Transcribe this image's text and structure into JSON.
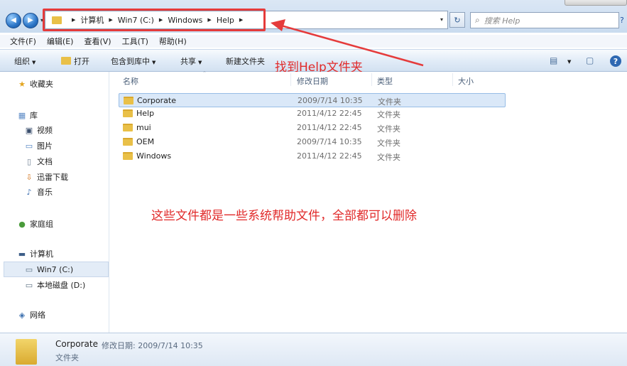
{
  "nav": {
    "back_glyph": "◀",
    "forward_glyph": "▶"
  },
  "address": {
    "crumbs": [
      "计算机",
      "Win7 (C:)",
      "Windows",
      "Help"
    ],
    "search_placeholder": "搜索 Help"
  },
  "menu": [
    "文件(F)",
    "编辑(E)",
    "查看(V)",
    "工具(T)",
    "帮助(H)"
  ],
  "toolbar": {
    "organize": "组织",
    "open": "打开",
    "include_in_library": "包含到库中",
    "share": "共享",
    "new_folder": "新建文件夹"
  },
  "sidebar": {
    "favorites": "收藏夹",
    "libraries": "库",
    "videos": "视频",
    "pictures": "图片",
    "documents": "文档",
    "xunlei_downloads": "迅雷下载",
    "music": "音乐",
    "homegroup": "家庭组",
    "computer": "计算机",
    "drive_c": "Win7 (C:)",
    "drive_d": "本地磁盘 (D:)",
    "network": "网络"
  },
  "columns": {
    "name": "名称",
    "modified": "修改日期",
    "type": "类型",
    "size": "大小"
  },
  "files": [
    {
      "name": "Corporate",
      "modified": "2009/7/14 10:35",
      "type": "文件夹"
    },
    {
      "name": "Help",
      "modified": "2011/4/12 22:45",
      "type": "文件夹"
    },
    {
      "name": "mui",
      "modified": "2011/4/12 22:45",
      "type": "文件夹"
    },
    {
      "name": "OEM",
      "modified": "2009/7/14 10:35",
      "type": "文件夹"
    },
    {
      "name": "Windows",
      "modified": "2011/4/12 22:45",
      "type": "文件夹"
    }
  ],
  "details": {
    "name": "Corporate",
    "modified_text": "修改日期: 2009/7/14 10:35",
    "type": "文件夹"
  },
  "annotations": {
    "find_folder": "找到Help文件夹",
    "note": "这些文件都是一些系统帮助文件，全部都可以删除",
    "color": "#e12a2a"
  },
  "icons": {
    "view": "▤",
    "preview_pane": "▢",
    "help": "?",
    "refresh": "↻",
    "search": "⌕"
  },
  "colors": {
    "accent": "#2e68b2",
    "selection": "#dae8f8",
    "folder": "#e9c048"
  }
}
